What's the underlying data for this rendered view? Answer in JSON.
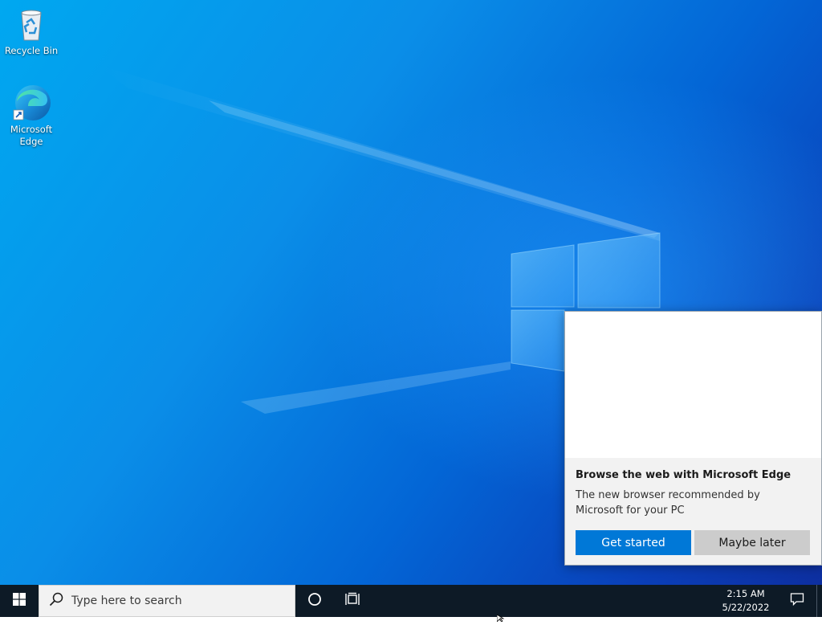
{
  "desktop": {
    "icons": [
      {
        "label": "Recycle Bin",
        "icon": "recycle-bin-icon"
      },
      {
        "label": "Microsoft Edge",
        "icon": "edge-icon"
      }
    ]
  },
  "flyout": {
    "title": "Browse the web with Microsoft Edge",
    "description": "The new browser recommended by Microsoft for your PC",
    "primary_label": "Get started",
    "secondary_label": "Maybe later"
  },
  "taskbar": {
    "start_icon": "windows-logo-icon",
    "search_placeholder": "Type here to search",
    "cortana_icon": "cortana-circle-icon",
    "task_view_icon": "task-view-icon",
    "time": "2:15 AM",
    "date": "5/22/2022",
    "notification_icon": "action-center-icon"
  },
  "colors": {
    "accent": "#0078d7",
    "taskbar": "#0d1a26"
  }
}
